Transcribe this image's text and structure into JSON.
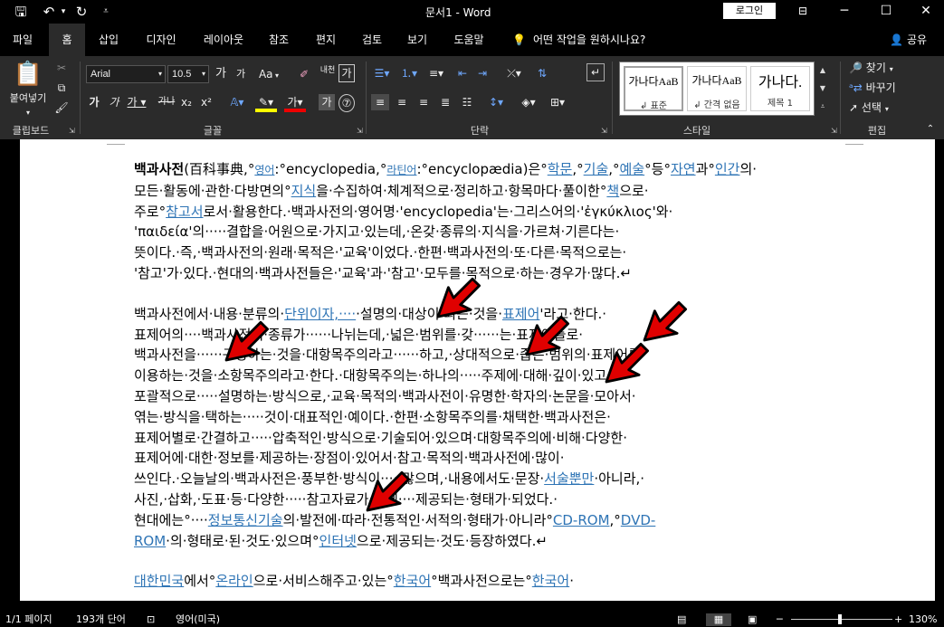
{
  "window": {
    "title": "문서1  -  Word",
    "login": "로그인"
  },
  "tabs": [
    {
      "label": "파일"
    },
    {
      "label": "홈"
    },
    {
      "label": "삽입"
    },
    {
      "label": "디자인"
    },
    {
      "label": "레이아웃"
    },
    {
      "label": "참조"
    },
    {
      "label": "편지"
    },
    {
      "label": "검토"
    },
    {
      "label": "보기"
    },
    {
      "label": "도움말"
    }
  ],
  "tellme": "어떤 작업을 원하시나요?",
  "share": "공유",
  "ribbon": {
    "clipboard": {
      "label": "클립보드",
      "paste": "붙여넣기"
    },
    "font": {
      "label": "글꼴",
      "name": "Arial",
      "size": "10.5",
      "phonetic": "내천",
      "aa": "Aa",
      "gul": "가"
    },
    "paragraph": {
      "label": "단락"
    },
    "styles": {
      "label": "스타일",
      "items": [
        {
          "preview": "가나다AaB",
          "name": "↲ 표준"
        },
        {
          "preview": "가나다AaB",
          "name": "↲ 간격 없음"
        },
        {
          "preview": "가나다.",
          "name": "제목 1"
        }
      ]
    },
    "editing": {
      "label": "편집",
      "find": "찾기",
      "replace": "바꾸기",
      "select": "선택"
    }
  },
  "document": {
    "paragraph1": [
      {
        "segs": [
          {
            "t": "백과사전",
            "c": "b"
          },
          {
            "t": "(百科事典,°"
          },
          {
            "t": "영어",
            "c": "lk sm"
          },
          {
            "t": ":°encyclopedia,°"
          },
          {
            "t": "라틴어",
            "c": "lk sm"
          },
          {
            "t": ":°encyclopædia)은°"
          },
          {
            "t": "학문",
            "c": "lk"
          },
          {
            "t": ",°"
          },
          {
            "t": "기술",
            "c": "lk"
          },
          {
            "t": ",°"
          },
          {
            "t": "예술",
            "c": "lk"
          },
          {
            "t": "°등°"
          },
          {
            "t": "자연",
            "c": "lk"
          },
          {
            "t": "과°"
          },
          {
            "t": "인간",
            "c": "lk"
          },
          {
            "t": "의·"
          }
        ]
      },
      {
        "segs": [
          {
            "t": "모든·활동에·관한·다방면의°"
          },
          {
            "t": "지식",
            "c": "lk"
          },
          {
            "t": "을·수집하여·체계적으로·정리하고·항목마다·풀이한°"
          },
          {
            "t": "책",
            "c": "lk"
          },
          {
            "t": "으로·"
          }
        ]
      },
      {
        "segs": [
          {
            "t": "주로°"
          },
          {
            "t": "참고서",
            "c": "lk"
          },
          {
            "t": "로서·활용한다.·백과사전의·영어명·'encyclopedia'는·그리스어의·'ἐγκύκλιος'와·"
          }
        ]
      },
      {
        "segs": [
          {
            "t": "'παιδεία'의·····결합을·어원으로·가지고·있는데,·온갖·종류의·지식을·가르쳐·기른다는·"
          }
        ]
      },
      {
        "segs": [
          {
            "t": "뜻이다.·즉,·백과사전의·원래·목적은·'교육'이었다.·한편·백과사전의·또·다른·목적으로는·"
          }
        ]
      },
      {
        "segs": [
          {
            "t": "'참고'가·있다.·현대의·백과사전들은·'교육'과·'참고'·모두를·목적으로·하는·경우가·많다.↵"
          }
        ]
      }
    ],
    "paragraph2": [
      {
        "segs": [
          {
            "t": "백과사전에서·내용·분류의·"
          },
          {
            "t": "단위이자,····",
            "c": "lk"
          },
          {
            "t": "·설명의·대상이·되는·것을·"
          },
          {
            "t": "표제어",
            "c": "lk"
          },
          {
            "t": "'라고·한다.·"
          }
        ]
      },
      {
        "segs": [
          {
            "t": "표제어의····백과사전의·종류가······나뉘는데,·넓은·범위를·갖······는·표제어들로·"
          }
        ]
      },
      {
        "segs": [
          {
            "t": "백과사전을······구성하는·것을·대항목주의라고······하고,·상대적으로·좁은·범위의·표제어를·"
          }
        ]
      },
      {
        "segs": [
          {
            "t": "이용하는·것을·소항목주의라고·한다.·대항목주의는·하나의·····주제에·대해·깊이·있고·"
          }
        ]
      },
      {
        "segs": [
          {
            "t": "포괄적으로·····설명하는·방식으로,·교육·목적의·백과사전이·유명한·학자의·논문을·모아서·"
          }
        ]
      },
      {
        "segs": [
          {
            "t": "엮는·방식을·택하는·····것이·대표적인·예이다.·한편·소항목주의를·채택한·백과사전은·"
          }
        ]
      },
      {
        "segs": [
          {
            "t": "표제어별로·간결하고·····압축적인·방식으로·기술되어·있으며·대항목주의에·비해·다양한·"
          }
        ]
      },
      {
        "segs": [
          {
            "t": "표제어에·대한·정보를·제공하는·장점이·있어서·참고·목적의·백과사전에·많이·"
          }
        ]
      },
      {
        "segs": [
          {
            "t": "쓰인다.·오늘날의·백과사전은·풍부한·방식이·····많으며,·내용에서도·문장·"
          },
          {
            "t": "서술뿐만",
            "c": "lk"
          },
          {
            "t": "·아니라,·"
          }
        ]
      },
      {
        "segs": [
          {
            "t": "사진,·삽화,·도표·등·다양한·····참고자료가·함께····제공되는·형태가·되었다.·"
          }
        ]
      },
      {
        "segs": [
          {
            "t": "현대에는°····"
          },
          {
            "t": "정보통신기술",
            "c": "lk"
          },
          {
            "t": "의·발전에·따라·전통적인·서적의·형태가·아니라°"
          },
          {
            "t": "CD-ROM",
            "c": "lk"
          },
          {
            "t": ",°"
          },
          {
            "t": "DVD-",
            "c": "lk"
          }
        ]
      },
      {
        "segs": [
          {
            "t": "ROM",
            "c": "lk"
          },
          {
            "t": "·의·형태로·된·것도·있으며°"
          },
          {
            "t": "인터넷",
            "c": "lk"
          },
          {
            "t": "으로·제공되는·것도·등장하였다.↵"
          }
        ]
      }
    ],
    "paragraph3": [
      {
        "segs": [
          {
            "t": "대한민국",
            "c": "lk"
          },
          {
            "t": "에서°"
          },
          {
            "t": "온라인",
            "c": "lk"
          },
          {
            "t": "으로·서비스해주고·있는°"
          },
          {
            "t": "한국어",
            "c": "lk"
          },
          {
            "t": "°백과사전으로는°"
          },
          {
            "t": "한국어",
            "c": "lk"
          },
          {
            "t": "·"
          }
        ]
      }
    ]
  },
  "statusbar": {
    "page": "1/1 페이지",
    "words": "193개 단어",
    "lang": "영어(미국)",
    "zoom": "130%"
  }
}
